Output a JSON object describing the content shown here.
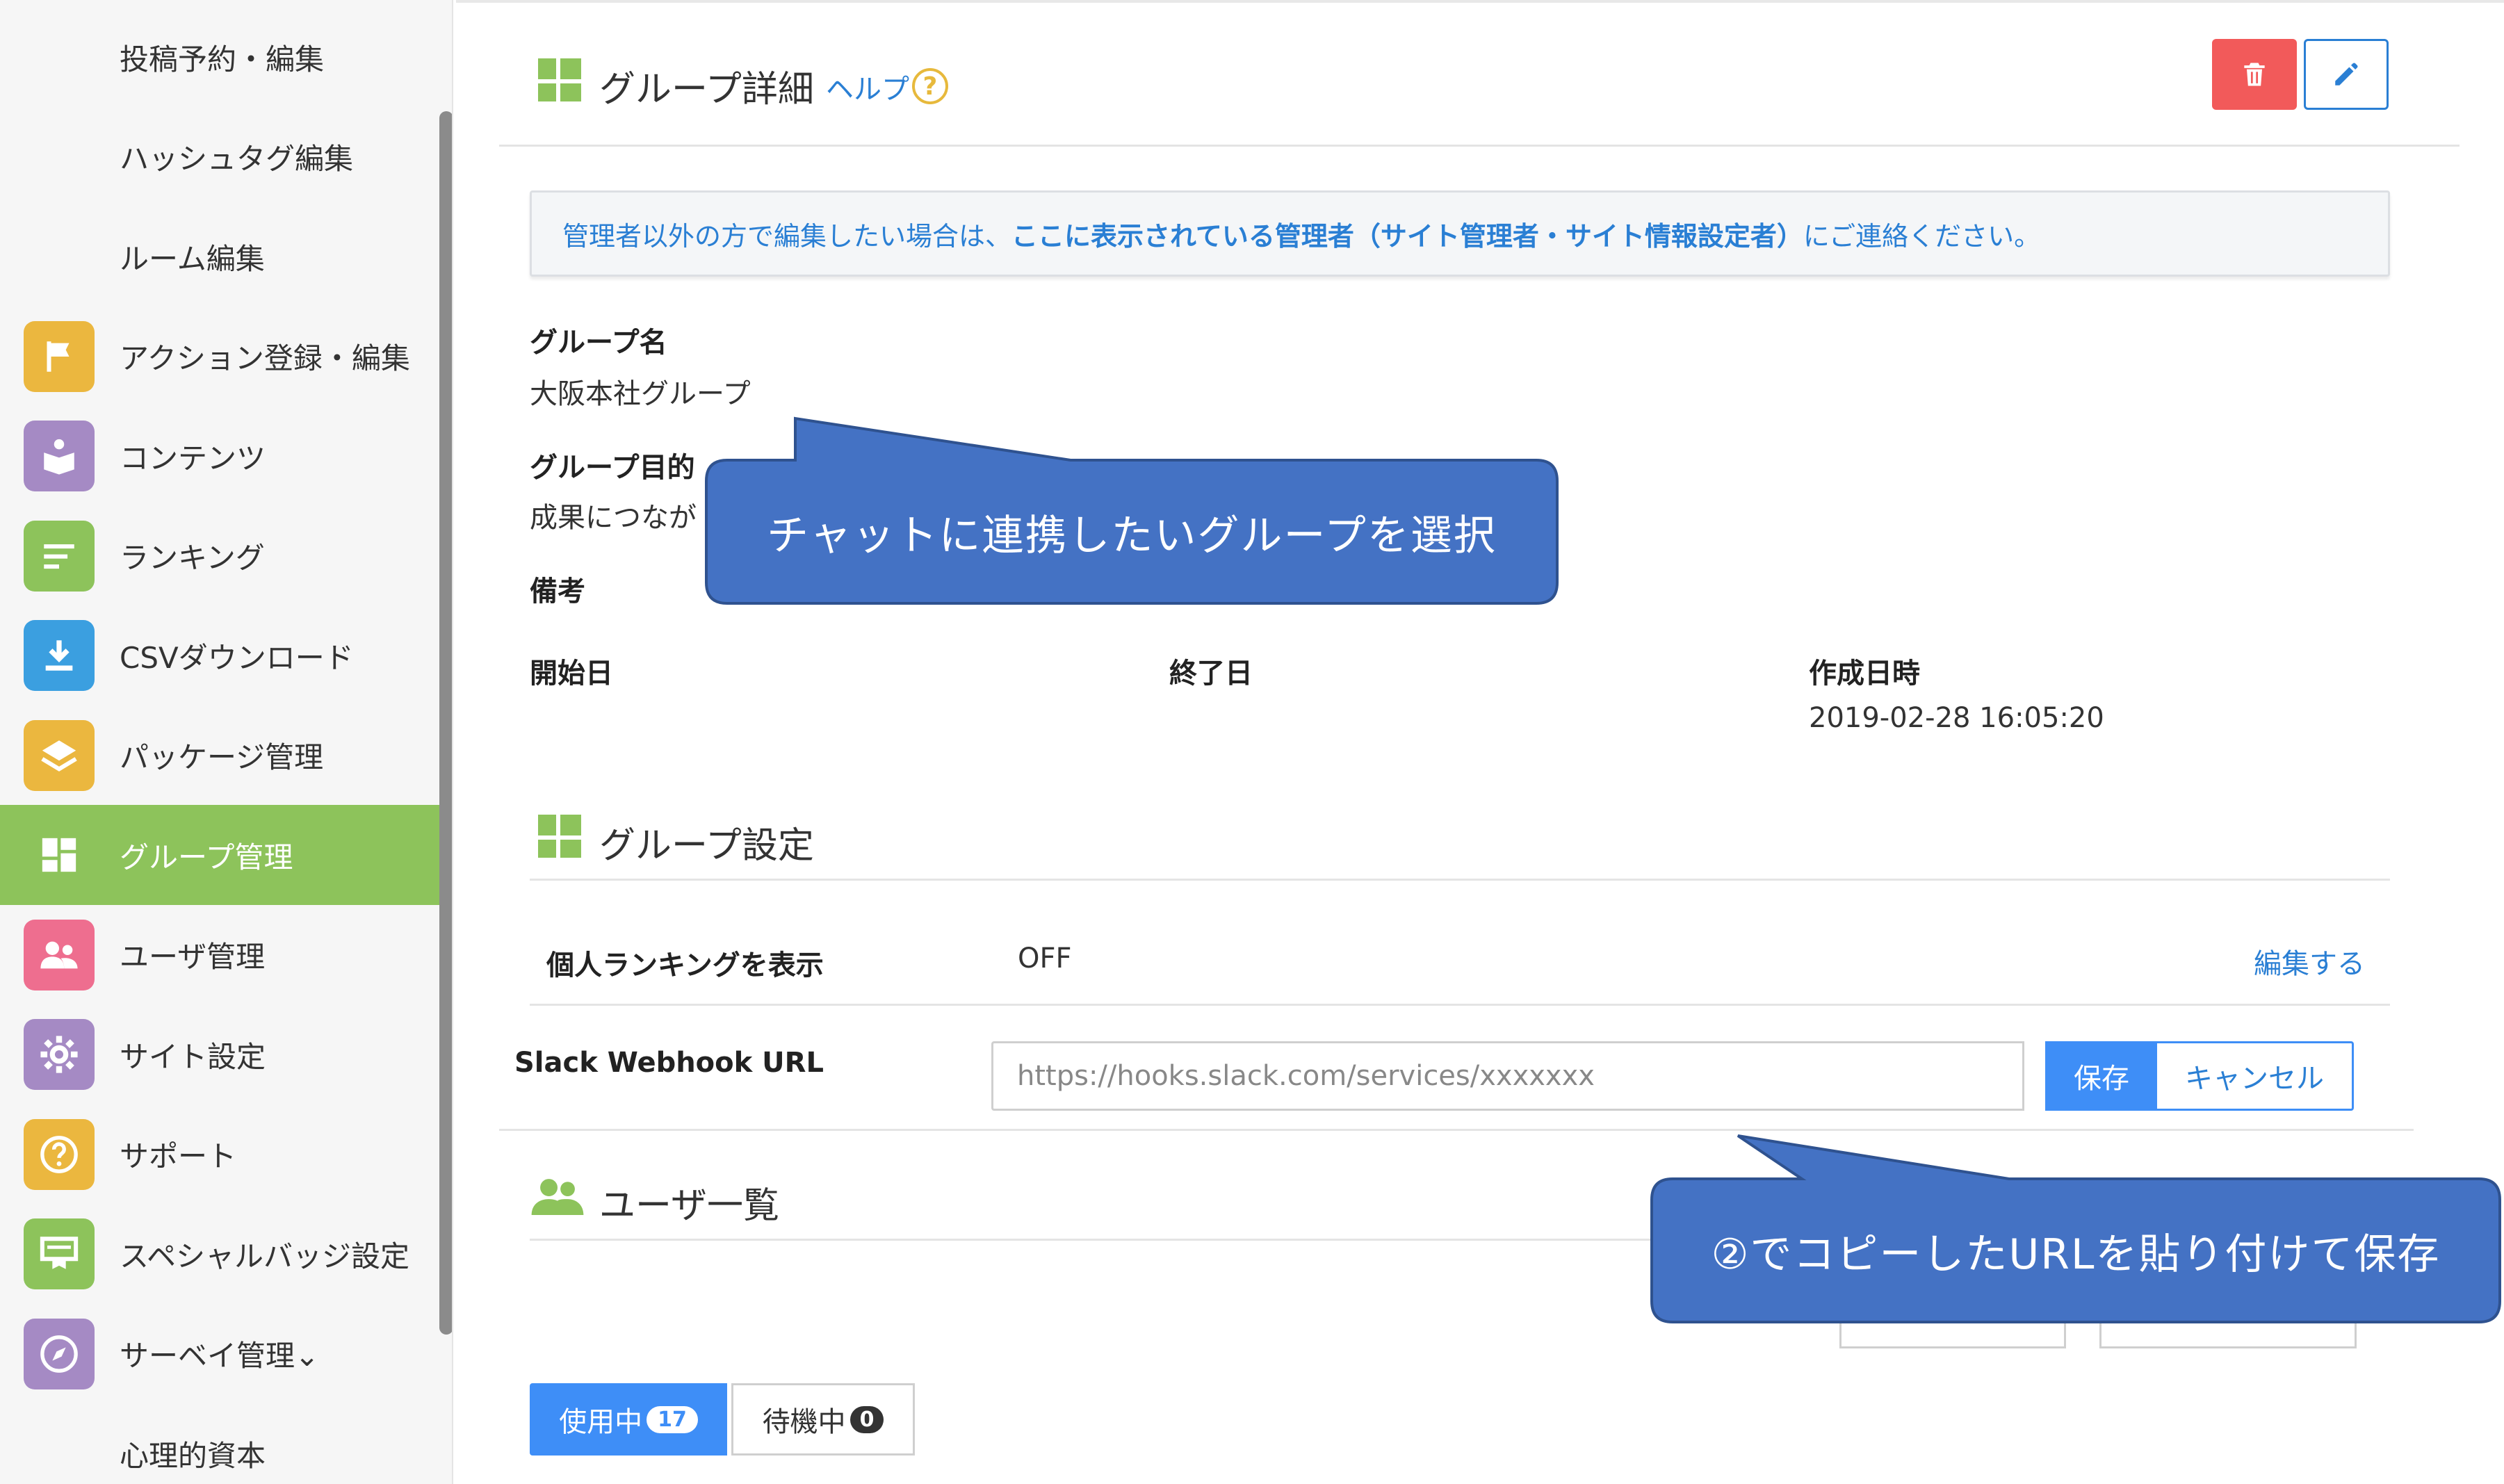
{
  "colors": {
    "accent_green": "#8dc35b",
    "link_blue": "#2a7fd4",
    "primary_blue": "#3e8ef7",
    "danger_red": "#f25a5a",
    "callout_blue": "#4472c4"
  },
  "sidebar": {
    "items": [
      {
        "label": "投稿予約・編集",
        "icon": "none",
        "active": false
      },
      {
        "label": "ハッシュタグ編集",
        "icon": "none",
        "active": false
      },
      {
        "label": "ルーム編集",
        "icon": "none",
        "active": false
      },
      {
        "label": "アクション登録・編集",
        "icon": "flag-icon",
        "color": "#ebb73f",
        "active": false
      },
      {
        "label": "コンテンツ",
        "icon": "book-icon",
        "color": "#a58ac4",
        "active": false
      },
      {
        "label": "ランキング",
        "icon": "list-icon",
        "color": "#8dc35b",
        "active": false
      },
      {
        "label": "CSVダウンロード",
        "icon": "download-icon",
        "color": "#3b9fe0",
        "active": false
      },
      {
        "label": "パッケージ管理",
        "icon": "layers-icon",
        "color": "#ebb73f",
        "active": false
      },
      {
        "label": "グループ管理",
        "icon": "grid-icon",
        "color": "#8dc35b",
        "active": true
      },
      {
        "label": "ユーザ管理",
        "icon": "users-icon",
        "color": "#ee6e8f",
        "active": false
      },
      {
        "label": "サイト設定",
        "icon": "gear-icon",
        "color": "#a58ac4",
        "active": false
      },
      {
        "label": "サポート",
        "icon": "help-icon",
        "color": "#ebb73f",
        "active": false
      },
      {
        "label": "スペシャルバッジ設定",
        "icon": "badge-icon",
        "color": "#8dc35b",
        "active": false
      },
      {
        "label": "サーベイ管理⌄",
        "icon": "compass-icon",
        "color": "#a58ac4",
        "active": false
      },
      {
        "label": "心理的資本",
        "icon": "none",
        "active": false
      }
    ]
  },
  "group_detail": {
    "title": "グループ詳細",
    "help_label": "ヘルプ",
    "help_icon_glyph": "?",
    "notice_prefix": "管理者以外の方で編集したい場合は、",
    "notice_emphasis": "ここに表示されている管理者（サイト管理者・サイト情報設定者）",
    "notice_suffix": "にご連絡ください。",
    "name_label": "グループ名",
    "name_value": "大阪本社グループ",
    "purpose_label": "グループ目的",
    "purpose_value": "成果につなが",
    "remarks_label": "備考",
    "start_label": "開始日",
    "end_label": "終了日",
    "created_label": "作成日時",
    "created_value": "2019-02-28 16:05:20"
  },
  "group_settings": {
    "title": "グループ設定",
    "ranking_label": "個人ランキングを表示",
    "ranking_value": "OFF",
    "edit_link": "編集する",
    "webhook_label": "Slack Webhook URL",
    "webhook_value": "https://hooks.slack.com/services/xxxxxxx",
    "save_label": "保存",
    "cancel_label": "キャンセル"
  },
  "user_list": {
    "title": "ユーザ一覧",
    "tab_active_label": "使用中",
    "tab_active_count": "17",
    "tab_waiting_label": "待機中",
    "tab_waiting_count": "0"
  },
  "callouts": {
    "select_group": "チャットに連携したいグループを選択",
    "paste_url": "②でコピーしたURLを貼り付けて保存"
  }
}
